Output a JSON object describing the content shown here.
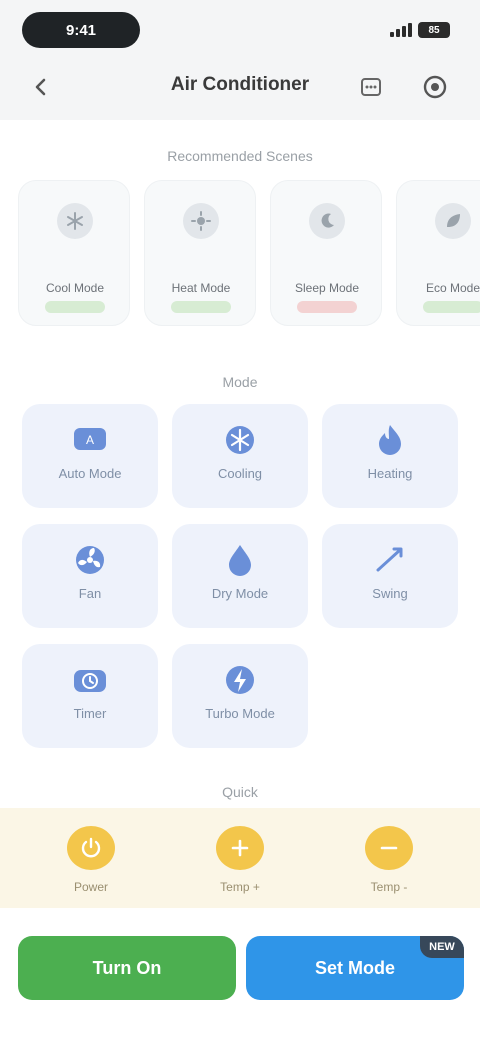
{
  "status_bar": {
    "time": "9:41",
    "battery": "85",
    "icon": "signal-icon"
  },
  "nav": {
    "title": "Air Conditioner",
    "back_icon": "back-arrow-icon",
    "more_icon": "more-icon",
    "target_icon": "target-icon"
  },
  "sections": {
    "scenes": "Recommended Scenes",
    "devices": "Mode",
    "quick": "Quick"
  },
  "scenes": [
    {
      "name": "Cool Mode",
      "icon": "snowflake-icon",
      "accent": "#d7ecd3"
    },
    {
      "name": "Heat Mode",
      "icon": "sun-icon",
      "accent": "#d7ecd3"
    },
    {
      "name": "Sleep Mode",
      "icon": "moon-icon",
      "accent": "#f3d2d2"
    },
    {
      "name": "Eco Mode",
      "icon": "leaf-icon",
      "accent": "#d7ecd3"
    }
  ],
  "devices": [
    {
      "name": "Auto Mode",
      "icon": "auto-icon"
    },
    {
      "name": "Cooling",
      "icon": "snowflake-icon"
    },
    {
      "name": "Heating",
      "icon": "flame-icon"
    },
    {
      "name": "Fan",
      "icon": "fan-icon"
    },
    {
      "name": "Dry Mode",
      "icon": "droplet-icon"
    },
    {
      "name": "Swing",
      "icon": "swing-icon"
    },
    {
      "name": "Timer",
      "icon": "timer-icon"
    },
    {
      "name": "Turbo Mode",
      "icon": "turbo-icon"
    }
  ],
  "quick": [
    {
      "name": "Power",
      "icon": "power-icon"
    },
    {
      "name": "Temp +",
      "icon": "plus-icon"
    },
    {
      "name": "Temp -",
      "icon": "minus-icon"
    }
  ],
  "actions": {
    "primary": "Turn On",
    "secondary": "Set Mode",
    "badge": "NEW"
  },
  "colors": {
    "green": "#4caf50",
    "blue": "#2f95e8",
    "yellow": "#f3c64b",
    "tile": "#eef2fb"
  }
}
